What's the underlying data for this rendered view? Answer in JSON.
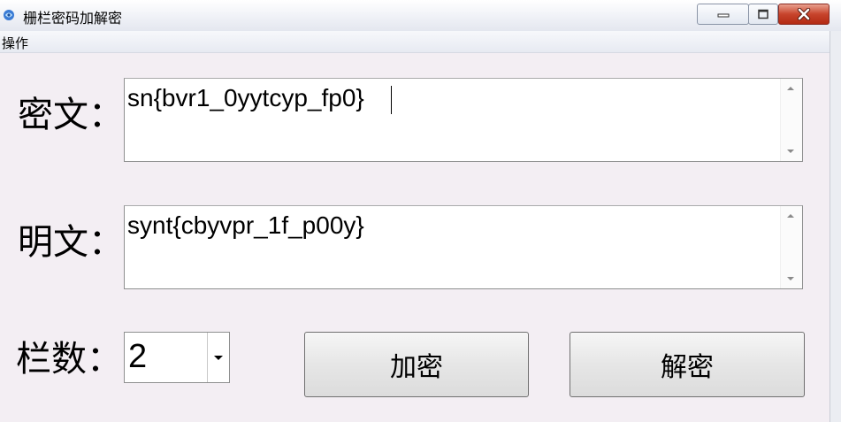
{
  "window": {
    "title": "栅栏密码加解密"
  },
  "menu": {
    "items": [
      {
        "label": "操作"
      }
    ]
  },
  "form": {
    "ciphertext_label": "密文：",
    "ciphertext_value": "sn{bvr1_0yytcyp_fp0}",
    "plaintext_label": "明文：",
    "plaintext_value": "synt{cbyvpr_1f_p00y}",
    "rails_label": "栏数：",
    "rails_value": "2"
  },
  "buttons": {
    "encrypt_label": "加密",
    "decrypt_label": "解密"
  },
  "colors": {
    "window_bg": "#f3eef3",
    "close_button": "#c7442c"
  }
}
